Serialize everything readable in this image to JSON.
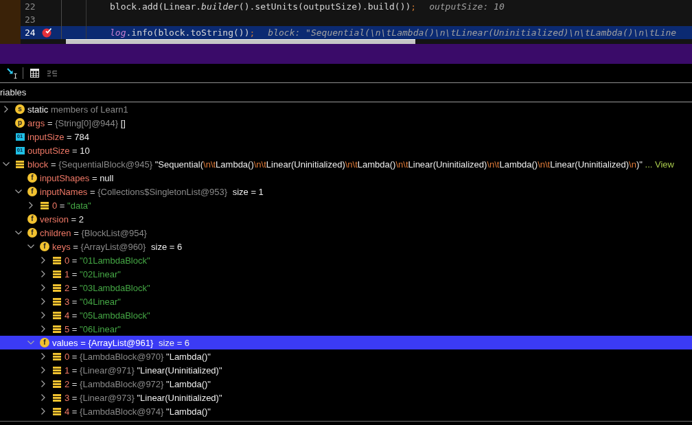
{
  "editor": {
    "lines": [
      {
        "number": "22",
        "breakpoint": false,
        "current": false,
        "code": [
          {
            "kind": "plain",
            "text": "block.add(Linear."
          },
          {
            "kind": "method",
            "text": "builder"
          },
          {
            "kind": "plain",
            "text": "().setUnits(outputSize).build())"
          },
          {
            "kind": "punct",
            "text": ";"
          }
        ],
        "hint": "outputSize: 10"
      },
      {
        "number": "23",
        "breakpoint": false,
        "current": false
      },
      {
        "number": "24",
        "breakpoint": true,
        "current": true,
        "code": [
          {
            "kind": "field",
            "text": "log"
          },
          {
            "kind": "plain",
            "text": ".info(block.toString())"
          },
          {
            "kind": "punct",
            "text": ";"
          }
        ],
        "hint": "block: \"Sequential(\\n\\tLambda()\\n\\tLinear(Uninitialized)\\n\\tLambda()\\n\\tLine"
      }
    ]
  },
  "toolbar": [
    {
      "kind": "cursor",
      "disabled": false
    },
    {
      "kind": "table",
      "disabled": false
    },
    {
      "kind": "lines",
      "disabled": true
    }
  ],
  "panel": {
    "title": "riables"
  },
  "tree": [
    {
      "icon": {
        "kind": "static",
        "letter": "s"
      },
      "name": "static",
      "note": "members of Learn1",
      "expanded": false,
      "selected": false
    },
    {
      "icon": {
        "kind": "parameter",
        "letter": "p"
      },
      "name": "args",
      "eq": "=",
      "type": "{String[0]@944}",
      "value": "[]",
      "string_literal": false,
      "selected": false
    },
    {
      "icon": {
        "kind": "primitive",
        "letter": "01"
      },
      "name": "inputSize",
      "eq": "=",
      "value": "784",
      "string_literal": false,
      "selected": false
    },
    {
      "icon": {
        "kind": "primitive",
        "letter": "01"
      },
      "name": "outputSize",
      "eq": "=",
      "value": "10",
      "string_literal": false,
      "selected": false
    },
    {
      "icon": {
        "kind": "object"
      },
      "name": "block",
      "eq": "=",
      "type": "{SequentialBlock@945}",
      "value": "\"Sequential(\\n\\tLambda()\\n\\tLinear(Uninitialized)\\n\\tLambda()\\n\\tLinear(Uninitialized)\\n\\tLambda()\\n\\tLinear(Uninitialized)\\n)\"",
      "string_literal": false,
      "more": "...",
      "link": "View",
      "expanded": true,
      "selected": false,
      "children": [
        {
          "icon": {
            "kind": "field",
            "letter": "f"
          },
          "name": "inputShapes",
          "eq": "=",
          "value": "null",
          "string_literal": false,
          "selected": false
        },
        {
          "icon": {
            "kind": "field",
            "letter": "f"
          },
          "name": "inputNames",
          "eq": "=",
          "type": "{Collections$SingletonList@953}",
          "size": "size = 1",
          "expanded": true,
          "selected": false,
          "children": [
            {
              "icon": {
                "kind": "object"
              },
              "name": "0",
              "eq": "=",
              "value": "\"data\"",
              "string_literal": true,
              "expanded": false,
              "selected": false
            }
          ]
        },
        {
          "icon": {
            "kind": "field",
            "letter": "f"
          },
          "name": "version",
          "eq": "=",
          "value": "2",
          "string_literal": false,
          "selected": false
        },
        {
          "icon": {
            "kind": "field",
            "letter": "f"
          },
          "name": "children",
          "eq": "=",
          "type": "{BlockList@954}",
          "expanded": true,
          "selected": false,
          "children": [
            {
              "icon": {
                "kind": "field",
                "letter": "f"
              },
              "name": "keys",
              "eq": "=",
              "type": "{ArrayList@960}",
              "size": "size = 6",
              "expanded": true,
              "selected": false,
              "children": [
                {
                  "icon": {
                    "kind": "object"
                  },
                  "name": "0",
                  "eq": "=",
                  "value": "\"01LambdaBlock\"",
                  "string_literal": true,
                  "expanded": false,
                  "selected": false
                },
                {
                  "icon": {
                    "kind": "object"
                  },
                  "name": "1",
                  "eq": "=",
                  "value": "\"02Linear\"",
                  "string_literal": true,
                  "expanded": false,
                  "selected": false
                },
                {
                  "icon": {
                    "kind": "object"
                  },
                  "name": "2",
                  "eq": "=",
                  "value": "\"03LambdaBlock\"",
                  "string_literal": true,
                  "expanded": false,
                  "selected": false
                },
                {
                  "icon": {
                    "kind": "object"
                  },
                  "name": "3",
                  "eq": "=",
                  "value": "\"04Linear\"",
                  "string_literal": true,
                  "expanded": false,
                  "selected": false
                },
                {
                  "icon": {
                    "kind": "object"
                  },
                  "name": "4",
                  "eq": "=",
                  "value": "\"05LambdaBlock\"",
                  "string_literal": true,
                  "expanded": false,
                  "selected": false
                },
                {
                  "icon": {
                    "kind": "object"
                  },
                  "name": "5",
                  "eq": "=",
                  "value": "\"06Linear\"",
                  "string_literal": true,
                  "expanded": false,
                  "selected": false
                }
              ]
            },
            {
              "icon": {
                "kind": "field",
                "letter": "f"
              },
              "name": "values",
              "eq": "=",
              "type": "{ArrayList@961}",
              "size": "size = 6",
              "expanded": true,
              "selected": true,
              "children": [
                {
                  "icon": {
                    "kind": "object"
                  },
                  "name": "0",
                  "eq": "=",
                  "type": "{LambdaBlock@970}",
                  "value": "\"Lambda()\"",
                  "string_literal": false,
                  "expanded": false,
                  "selected": false
                },
                {
                  "icon": {
                    "kind": "object"
                  },
                  "name": "1",
                  "eq": "=",
                  "type": "{Linear@971}",
                  "value": "\"Linear(Uninitialized)\"",
                  "string_literal": false,
                  "expanded": false,
                  "selected": false
                },
                {
                  "icon": {
                    "kind": "object"
                  },
                  "name": "2",
                  "eq": "=",
                  "type": "{LambdaBlock@972}",
                  "value": "\"Lambda()\"",
                  "string_literal": false,
                  "expanded": false,
                  "selected": false
                },
                {
                  "icon": {
                    "kind": "object"
                  },
                  "name": "3",
                  "eq": "=",
                  "type": "{Linear@973}",
                  "value": "\"Linear(Uninitialized)\"",
                  "string_literal": false,
                  "expanded": false,
                  "selected": false
                },
                {
                  "icon": {
                    "kind": "object"
                  },
                  "name": "4",
                  "eq": "=",
                  "type": "{LambdaBlock@974}",
                  "value": "\"Lambda()\"",
                  "string_literal": false,
                  "expanded": false,
                  "selected": false
                }
              ]
            }
          ]
        }
      ]
    }
  ]
}
